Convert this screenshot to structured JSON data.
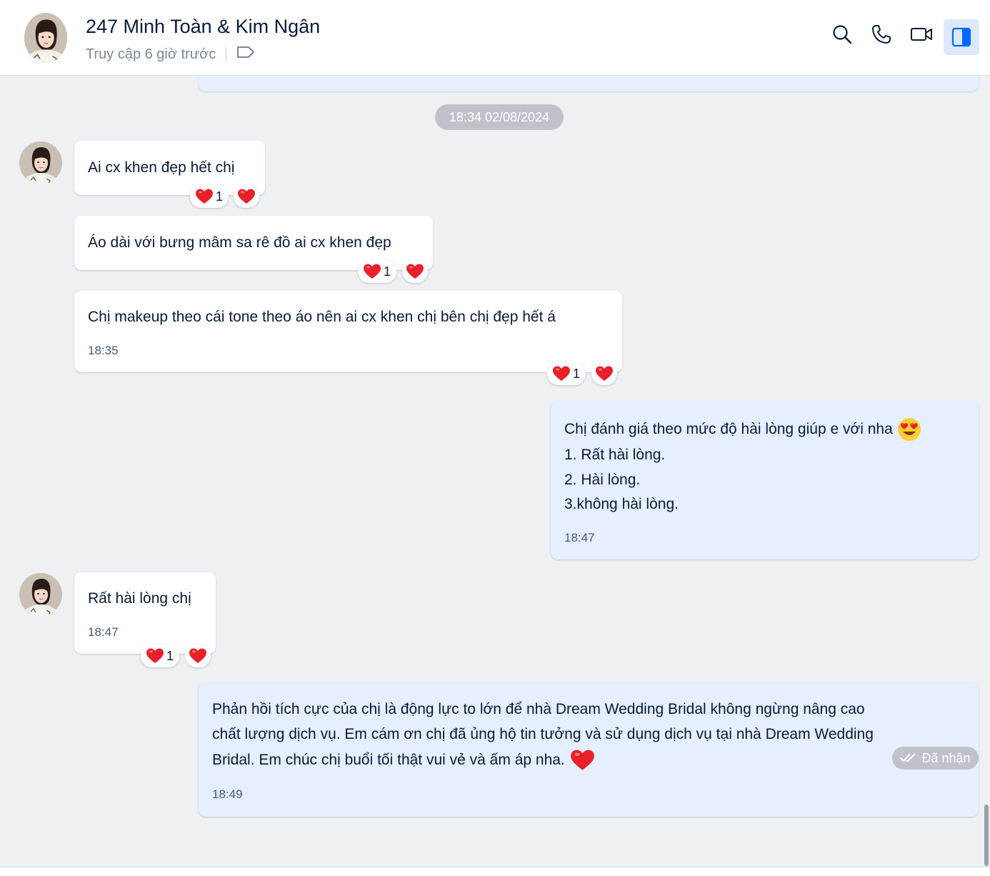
{
  "header": {
    "contact_name": "247 Minh Toàn & Kim Ngân",
    "last_seen": "Truy cập 6 giờ trước",
    "icons": [
      "search-icon",
      "phone-icon",
      "video-call-icon",
      "sidebar-toggle-icon"
    ]
  },
  "date_separator": "18:34 02/08/2024",
  "messages": [
    {
      "sender": "them",
      "text": "Ai cx khen đẹp hết chị",
      "time": "",
      "reaction_count": "1"
    },
    {
      "sender": "them",
      "text": "Áo dài với bưng mâm sa rê đồ ai cx khen đẹp",
      "time": "",
      "reaction_count": "1"
    },
    {
      "sender": "them",
      "text": "Chị makeup theo cái tone theo áo nên ai cx khen chị bên chị đẹp hết á",
      "time": "18:35",
      "reaction_count": "1"
    },
    {
      "sender": "me",
      "lines": [
        "Chị đánh giá theo mức độ hài lòng giúp e với nha",
        "1. Rất hài lòng.",
        "2. Hài lòng.",
        "3.không hài lòng."
      ],
      "time": "18:47"
    },
    {
      "sender": "them",
      "text": "Rất hài lòng chị",
      "time": "18:47",
      "reaction_count": "1"
    },
    {
      "sender": "me",
      "lines": [
        "Phản hồi tích cực của chị là động lực to lớn để nhà Dream Wedding Bridal không ngừng nâng cao",
        "chất lượng dịch vụ. Em cám ơn chị đã ủng hộ tin tưởng và sử dụng dịch vụ tại nhà Dream Wedding",
        "Bridal. Em chúc chị buổi tối thật vui vẻ và ấm áp nha."
      ],
      "time": "18:49"
    }
  ],
  "status": "Đã nhận",
  "colors": {
    "accent": "#0068ff",
    "my_bubble": "#e5efff",
    "heart": "#e8202a"
  }
}
